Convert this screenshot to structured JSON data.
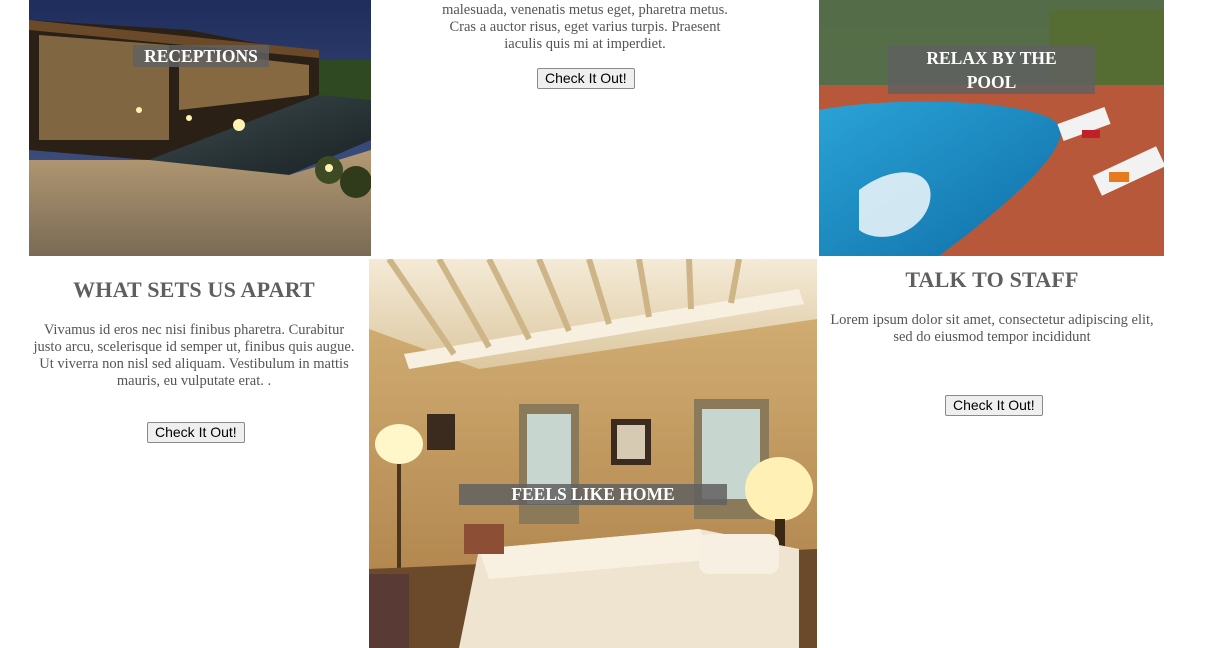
{
  "tiles": {
    "receptions": {
      "caption": "Receptions"
    },
    "pool": {
      "caption": "Relax by the pool"
    },
    "home": {
      "caption": "Feels like home"
    }
  },
  "top_text": {
    "paragraph": "malesuada, venenatis metus eget, pharetra metus. Cras a auctor risus, eget varius turpis. Praesent iaculis quis mi at imperdiet.",
    "button": "Check It Out!"
  },
  "apart": {
    "heading": "What sets us apart",
    "paragraph": "Vivamus id eros nec nisi finibus pharetra. Curabitur justo arcu, scelerisque id semper ut, finibus quis augue. Ut viverra non nisl sed aliquam. Vestibulum in mattis mauris, eu vulputate erat. .",
    "button": "Check It Out!"
  },
  "staff": {
    "heading": "Talk to staff",
    "paragraph": "Lorem ipsum dolor sit amet, consectetur adipiscing elit, sed do eiusmod tempor incididunt",
    "button": "Check It Out!"
  }
}
